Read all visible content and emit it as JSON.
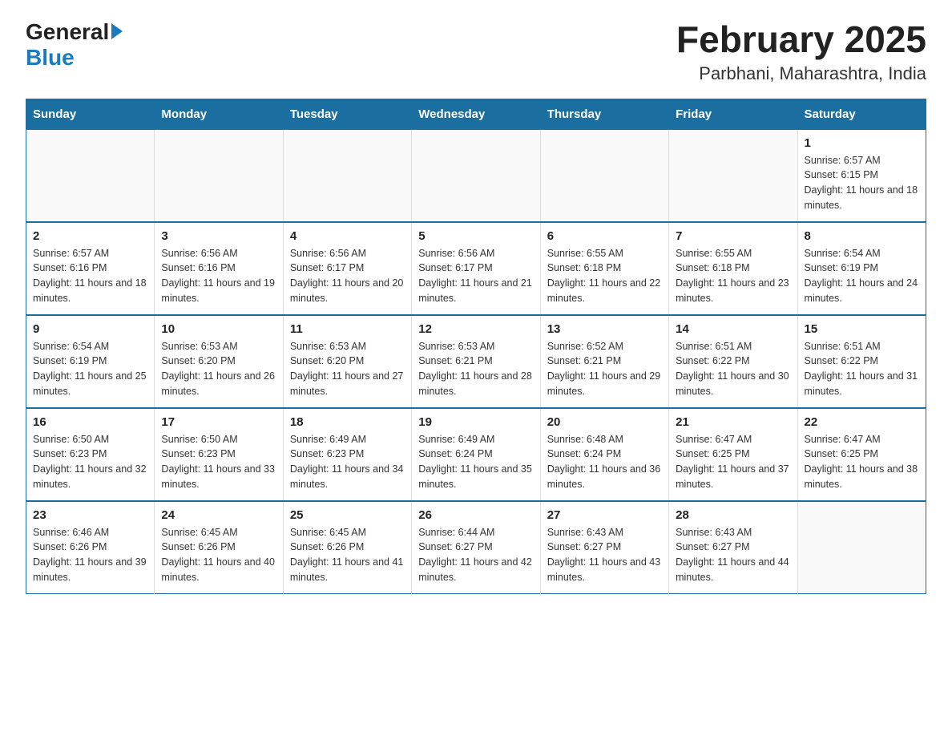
{
  "logo": {
    "general": "General",
    "blue": "Blue"
  },
  "title": "February 2025",
  "subtitle": "Parbhani, Maharashtra, India",
  "days_of_week": [
    "Sunday",
    "Monday",
    "Tuesday",
    "Wednesday",
    "Thursday",
    "Friday",
    "Saturday"
  ],
  "weeks": [
    [
      {
        "day": "",
        "info": ""
      },
      {
        "day": "",
        "info": ""
      },
      {
        "day": "",
        "info": ""
      },
      {
        "day": "",
        "info": ""
      },
      {
        "day": "",
        "info": ""
      },
      {
        "day": "",
        "info": ""
      },
      {
        "day": "1",
        "sunrise": "Sunrise: 6:57 AM",
        "sunset": "Sunset: 6:15 PM",
        "daylight": "Daylight: 11 hours and 18 minutes."
      }
    ],
    [
      {
        "day": "2",
        "sunrise": "Sunrise: 6:57 AM",
        "sunset": "Sunset: 6:16 PM",
        "daylight": "Daylight: 11 hours and 18 minutes."
      },
      {
        "day": "3",
        "sunrise": "Sunrise: 6:56 AM",
        "sunset": "Sunset: 6:16 PM",
        "daylight": "Daylight: 11 hours and 19 minutes."
      },
      {
        "day": "4",
        "sunrise": "Sunrise: 6:56 AM",
        "sunset": "Sunset: 6:17 PM",
        "daylight": "Daylight: 11 hours and 20 minutes."
      },
      {
        "day": "5",
        "sunrise": "Sunrise: 6:56 AM",
        "sunset": "Sunset: 6:17 PM",
        "daylight": "Daylight: 11 hours and 21 minutes."
      },
      {
        "day": "6",
        "sunrise": "Sunrise: 6:55 AM",
        "sunset": "Sunset: 6:18 PM",
        "daylight": "Daylight: 11 hours and 22 minutes."
      },
      {
        "day": "7",
        "sunrise": "Sunrise: 6:55 AM",
        "sunset": "Sunset: 6:18 PM",
        "daylight": "Daylight: 11 hours and 23 minutes."
      },
      {
        "day": "8",
        "sunrise": "Sunrise: 6:54 AM",
        "sunset": "Sunset: 6:19 PM",
        "daylight": "Daylight: 11 hours and 24 minutes."
      }
    ],
    [
      {
        "day": "9",
        "sunrise": "Sunrise: 6:54 AM",
        "sunset": "Sunset: 6:19 PM",
        "daylight": "Daylight: 11 hours and 25 minutes."
      },
      {
        "day": "10",
        "sunrise": "Sunrise: 6:53 AM",
        "sunset": "Sunset: 6:20 PM",
        "daylight": "Daylight: 11 hours and 26 minutes."
      },
      {
        "day": "11",
        "sunrise": "Sunrise: 6:53 AM",
        "sunset": "Sunset: 6:20 PM",
        "daylight": "Daylight: 11 hours and 27 minutes."
      },
      {
        "day": "12",
        "sunrise": "Sunrise: 6:53 AM",
        "sunset": "Sunset: 6:21 PM",
        "daylight": "Daylight: 11 hours and 28 minutes."
      },
      {
        "day": "13",
        "sunrise": "Sunrise: 6:52 AM",
        "sunset": "Sunset: 6:21 PM",
        "daylight": "Daylight: 11 hours and 29 minutes."
      },
      {
        "day": "14",
        "sunrise": "Sunrise: 6:51 AM",
        "sunset": "Sunset: 6:22 PM",
        "daylight": "Daylight: 11 hours and 30 minutes."
      },
      {
        "day": "15",
        "sunrise": "Sunrise: 6:51 AM",
        "sunset": "Sunset: 6:22 PM",
        "daylight": "Daylight: 11 hours and 31 minutes."
      }
    ],
    [
      {
        "day": "16",
        "sunrise": "Sunrise: 6:50 AM",
        "sunset": "Sunset: 6:23 PM",
        "daylight": "Daylight: 11 hours and 32 minutes."
      },
      {
        "day": "17",
        "sunrise": "Sunrise: 6:50 AM",
        "sunset": "Sunset: 6:23 PM",
        "daylight": "Daylight: 11 hours and 33 minutes."
      },
      {
        "day": "18",
        "sunrise": "Sunrise: 6:49 AM",
        "sunset": "Sunset: 6:23 PM",
        "daylight": "Daylight: 11 hours and 34 minutes."
      },
      {
        "day": "19",
        "sunrise": "Sunrise: 6:49 AM",
        "sunset": "Sunset: 6:24 PM",
        "daylight": "Daylight: 11 hours and 35 minutes."
      },
      {
        "day": "20",
        "sunrise": "Sunrise: 6:48 AM",
        "sunset": "Sunset: 6:24 PM",
        "daylight": "Daylight: 11 hours and 36 minutes."
      },
      {
        "day": "21",
        "sunrise": "Sunrise: 6:47 AM",
        "sunset": "Sunset: 6:25 PM",
        "daylight": "Daylight: 11 hours and 37 minutes."
      },
      {
        "day": "22",
        "sunrise": "Sunrise: 6:47 AM",
        "sunset": "Sunset: 6:25 PM",
        "daylight": "Daylight: 11 hours and 38 minutes."
      }
    ],
    [
      {
        "day": "23",
        "sunrise": "Sunrise: 6:46 AM",
        "sunset": "Sunset: 6:26 PM",
        "daylight": "Daylight: 11 hours and 39 minutes."
      },
      {
        "day": "24",
        "sunrise": "Sunrise: 6:45 AM",
        "sunset": "Sunset: 6:26 PM",
        "daylight": "Daylight: 11 hours and 40 minutes."
      },
      {
        "day": "25",
        "sunrise": "Sunrise: 6:45 AM",
        "sunset": "Sunset: 6:26 PM",
        "daylight": "Daylight: 11 hours and 41 minutes."
      },
      {
        "day": "26",
        "sunrise": "Sunrise: 6:44 AM",
        "sunset": "Sunset: 6:27 PM",
        "daylight": "Daylight: 11 hours and 42 minutes."
      },
      {
        "day": "27",
        "sunrise": "Sunrise: 6:43 AM",
        "sunset": "Sunset: 6:27 PM",
        "daylight": "Daylight: 11 hours and 43 minutes."
      },
      {
        "day": "28",
        "sunrise": "Sunrise: 6:43 AM",
        "sunset": "Sunset: 6:27 PM",
        "daylight": "Daylight: 11 hours and 44 minutes."
      },
      {
        "day": "",
        "info": ""
      }
    ]
  ]
}
